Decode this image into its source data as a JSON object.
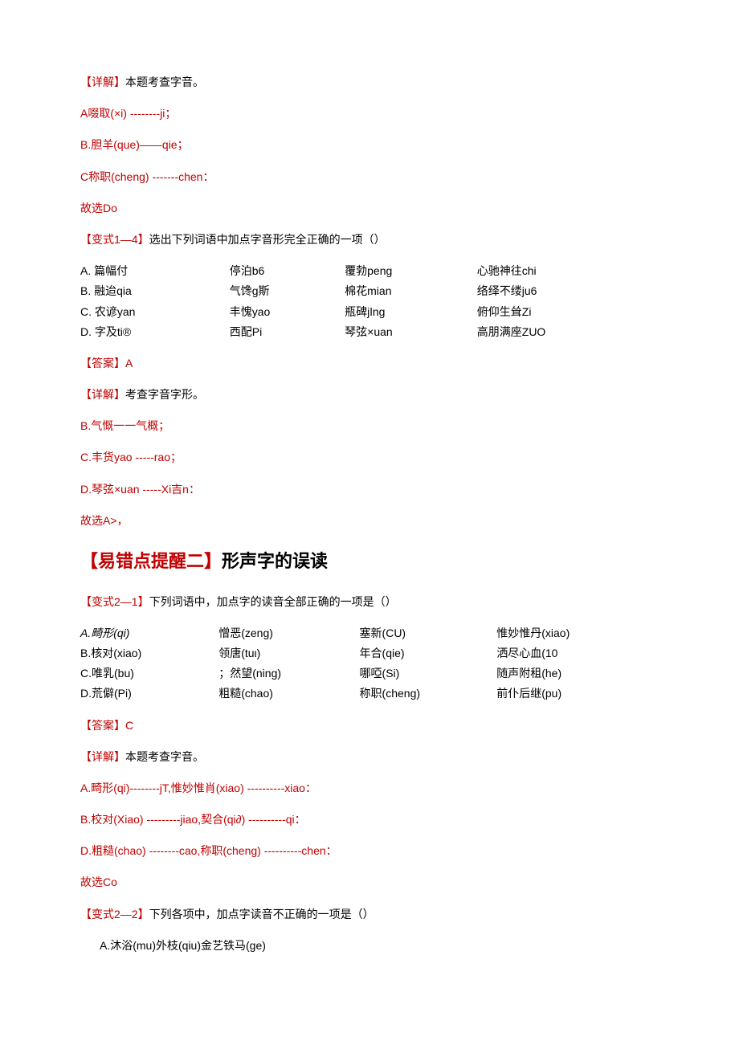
{
  "block1": {
    "l1_a": "【详解】",
    "l1_b": "本题考查字音。",
    "l2": "A啜取(×i) --------ji；",
    "l3": "B.胆羊(que)——qie；",
    "l4": "C称职(cheng) -------chen：",
    "l5": "故选Do",
    "l6_a": "【变式1—4】",
    "l6_b": "选出下列词语中加点字音形完全正确的一项（）"
  },
  "tbl1": {
    "r1": {
      "c1": "A. 篇幅付",
      "c2": "停泊b6",
      "c3": "覆勃peng",
      "c4": "心驰神往chi"
    },
    "r2": {
      "c1": "B. 融迨qia",
      "c2": "气馋ɡ斯",
      "c3": "棉花mian",
      "c4": "络绎不缕ju6"
    },
    "r3": {
      "c1": "C. 农谚yan",
      "c2": "丰愧yao",
      "c3": "瓶碑jǀng",
      "c4": "俯仰生耸Zi"
    },
    "r4": {
      "c1": "D. 字及ti®",
      "c2": "西配Pi",
      "c3": "琴弦×uan",
      "c4": "高朋满座ZUO"
    }
  },
  "block2": {
    "l1_a": "【答案】",
    "l1_b": "A",
    "l2_a": "【详解】",
    "l2_b": "考查字音字形。",
    "l3": "B.气慨一一气概；",
    "l4": "C.丰货yao -----rao；",
    "l5": "D.琴弦×uan -----Xi吉n：",
    "l6": "故选A>，"
  },
  "heading2": {
    "a": "【易错点提醒二】",
    "b": "形声字的误读"
  },
  "block3": {
    "l1_a": "【变式2—1】",
    "l1_b": "下列词语中，加点字的读音全部正确的一项是（）"
  },
  "tbl2": {
    "r1": {
      "c1": "A.畸形(qi)",
      "c2": "憎恶(zeng)",
      "c3": "塞新(CU)",
      "c4": "惟妙惟丹(xiao)"
    },
    "r2": {
      "c1": "B.核对(xiao)",
      "c2": "领唐(tuι)",
      "c3": "年合(qie)",
      "c4": "洒尽心血(10"
    },
    "r3": {
      "c1": "C.唯乳(bu)",
      "c2": "；然望(ning)",
      "c3": "哪啞(Si)",
      "c4": "随声附租(he)"
    },
    "r4": {
      "c1": "D.荒僻(Pi)",
      "c2": "粗糙(chao)",
      "c3": "称职(cheng)",
      "c4": "前仆后继(pu)"
    }
  },
  "block4": {
    "l1_a": "【答案】",
    "l1_b": "C",
    "l2_a": "【详解】",
    "l2_b": "本题考查字音。",
    "l3": "A.畸形(qi)--------jT,惟妙惟肖(xiao) ----------xiao：",
    "l4": "B.校对(Xiao) ---------jiao,契合(qi∂) ----------qi：",
    "l5": "D.粗糙(chao) --------cao,称职(cheng) ----------chen：",
    "l6": "故选Co",
    "l7_a": "【变式2—2】",
    "l7_b": "下列各项中，加点字读音不正确的一项是（）",
    "l8": "A.沐浴(mu)外枝(qiu)金艺铁马(ge)"
  }
}
